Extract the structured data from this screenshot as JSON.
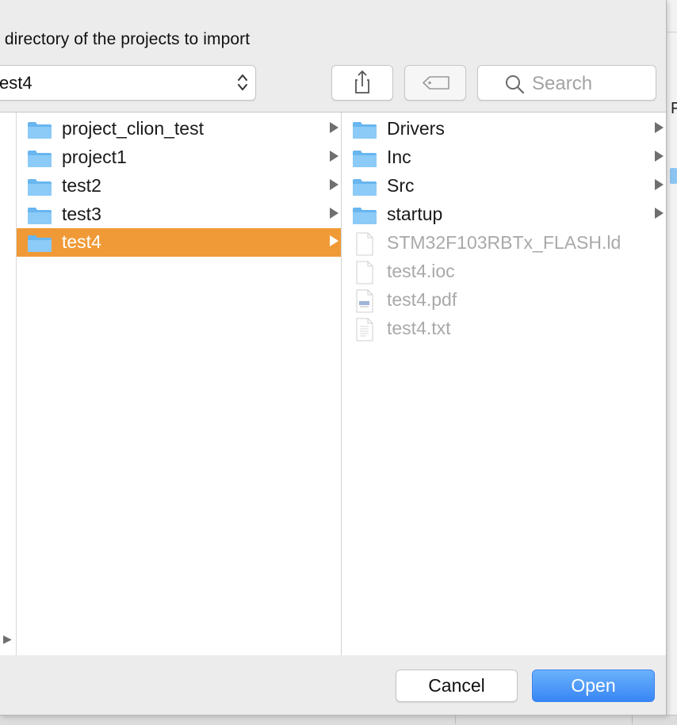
{
  "dialog": {
    "title": "t directory of the projects to import",
    "location": "est4",
    "search_placeholder": "Search"
  },
  "columns": {
    "middle": [
      {
        "name": "project_clion_test",
        "type": "folder",
        "selected": false
      },
      {
        "name": "project1",
        "type": "folder",
        "selected": false
      },
      {
        "name": "test2",
        "type": "folder",
        "selected": false
      },
      {
        "name": "test3",
        "type": "folder",
        "selected": false
      },
      {
        "name": "test4",
        "type": "folder",
        "selected": true
      }
    ],
    "right": [
      {
        "name": "Drivers",
        "type": "folder"
      },
      {
        "name": "Inc",
        "type": "folder"
      },
      {
        "name": "Src",
        "type": "folder"
      },
      {
        "name": "startup",
        "type": "folder"
      },
      {
        "name": "STM32F103RBTx_FLASH.ld",
        "type": "file",
        "disabled": true
      },
      {
        "name": "test4.ioc",
        "type": "file",
        "disabled": true
      },
      {
        "name": "test4.pdf",
        "type": "pdf",
        "disabled": true
      },
      {
        "name": "test4.txt",
        "type": "text",
        "disabled": true
      }
    ]
  },
  "buttons": {
    "cancel": "Cancel",
    "open": "Open"
  },
  "background": {
    "right_glyph": "F"
  },
  "colors": {
    "selection": "#f09a37",
    "folder": "#69b6f0",
    "primary_button": "#3886f5"
  }
}
